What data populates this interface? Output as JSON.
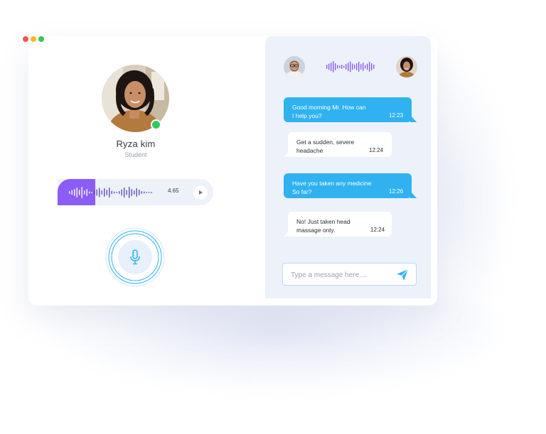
{
  "window": {
    "controls": [
      {
        "name": "close",
        "color": "#f2545b"
      },
      {
        "name": "minimize",
        "color": "#f7b924"
      },
      {
        "name": "maximize",
        "color": "#35c759"
      }
    ]
  },
  "profile": {
    "name": "Ryza kim",
    "role": "Student",
    "status": "online",
    "status_color": "#2fcb5c",
    "avatar_icon": "woman-portrait-icon"
  },
  "voice_message": {
    "duration": "4.65",
    "progress": 0.24,
    "accent": "#8b5cf6",
    "play_icon": "play-icon"
  },
  "mic": {
    "icon": "microphone-icon",
    "accent": "#2fb2ef"
  },
  "chat": {
    "header": {
      "doctor_avatar_icon": "man-portrait-icon",
      "patient_avatar_icon": "woman-portrait-icon",
      "wave_icon": "sound-wave-icon"
    },
    "messages": [
      {
        "direction": "outgoing",
        "lines": [
          "Good morning Mr. How can",
          "I help you?"
        ],
        "time": "12:23"
      },
      {
        "direction": "incoming",
        "lines": [
          "Get a sudden, severe",
          "headache"
        ],
        "time": "12:24"
      },
      {
        "direction": "outgoing",
        "lines": [
          "Have you taken any medicine",
          "So far?"
        ],
        "time": "12:26"
      },
      {
        "direction": "incoming",
        "lines": [
          "No! Just taken head",
          "massage only."
        ],
        "time": "12:24"
      }
    ],
    "input": {
      "placeholder": "Type a message here....",
      "value": "",
      "send_icon": "send-icon"
    }
  },
  "colors": {
    "bubble_out": "#2fb2ef",
    "panel_bg": "#ecf1fa",
    "wave": "#8b5cf6"
  }
}
